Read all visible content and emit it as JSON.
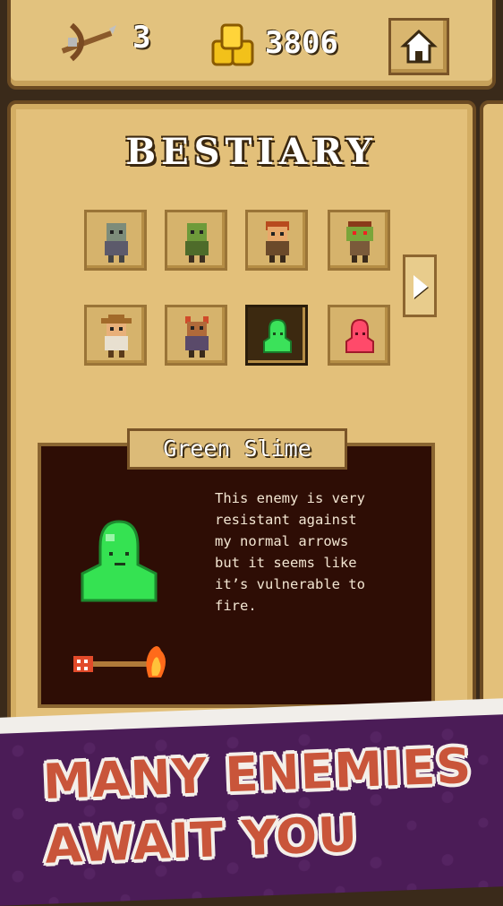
{
  "hud": {
    "arrows": "3",
    "gold": "3806"
  },
  "bestiary": {
    "title": "BESTIARY",
    "creatures": [
      {
        "name": "zombie",
        "selected": false
      },
      {
        "name": "green-orc",
        "selected": false
      },
      {
        "name": "red-haired-bandit",
        "selected": false
      },
      {
        "name": "goblin",
        "selected": false
      },
      {
        "name": "hat-rogue",
        "selected": false
      },
      {
        "name": "horned-rogue",
        "selected": false
      },
      {
        "name": "green-slime",
        "selected": true
      },
      {
        "name": "red-slime",
        "selected": false
      }
    ],
    "selected_name": "Green Slime",
    "description": "This enemy is very\nresistant  against\nmy normal arrows\nbut it seems like\nit’s vulnerable to\nfire."
  },
  "banner": {
    "line1": "MANY ENEMIES",
    "line2": "AWAIT YOU"
  },
  "colors": {
    "panel": "#e3c07a",
    "border": "#6b4a22",
    "info_bg": "#2e0d05",
    "banner_bg": "#4b1c57",
    "tagline": "#c9553a"
  }
}
